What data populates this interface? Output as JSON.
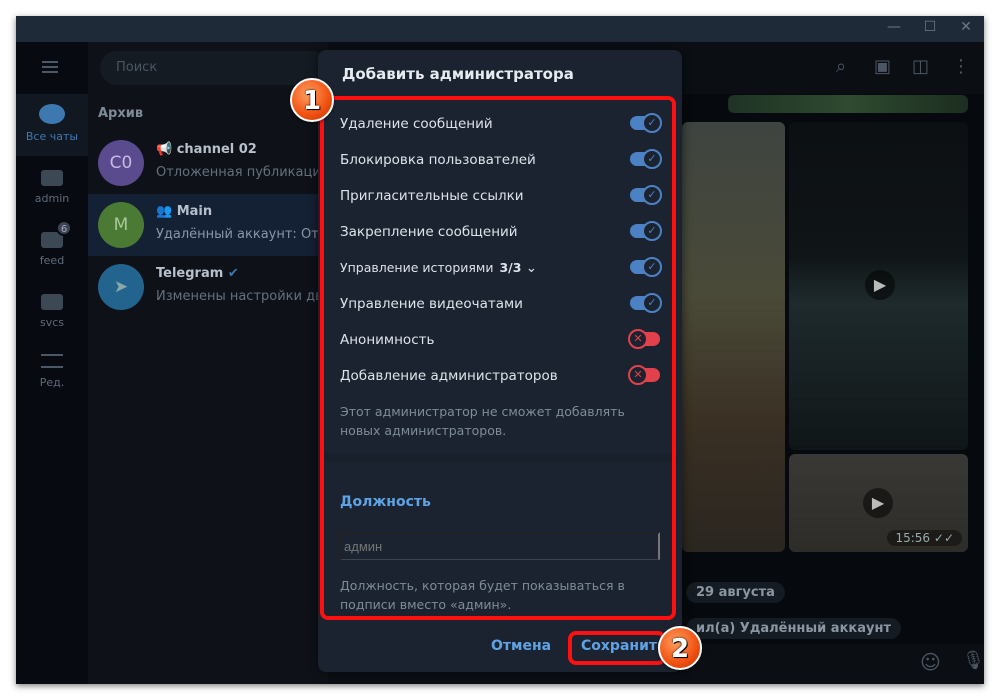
{
  "window": {
    "minimize": "—",
    "maximize": "☐",
    "close": "✕"
  },
  "sidebar": {
    "items": [
      {
        "label": "Все чаты",
        "icon": "chats-icon",
        "active": true
      },
      {
        "label": "admin",
        "icon": "folder-icon"
      },
      {
        "label": "feed",
        "icon": "folder-icon",
        "badge": "6"
      },
      {
        "label": "svcs",
        "icon": "folder-icon"
      },
      {
        "label": "Ред.",
        "icon": "sliders-icon"
      }
    ]
  },
  "chatlist": {
    "search_placeholder": "Поиск",
    "section": "Архив",
    "chats": [
      {
        "avatar": "C0",
        "name": "channel 02",
        "preview": "Отложенная публикация",
        "color": "#5a4a8e"
      },
      {
        "avatar": "M",
        "name": "Main",
        "preview": "Удалённый аккаунт: Отложено",
        "color": "#4a7a34"
      },
      {
        "avatar": "",
        "name": "Telegram",
        "preview": "Изменены настройки двухэтапной",
        "color": "#23648f"
      }
    ]
  },
  "chat": {
    "time": "15:56",
    "date_pill": "29 августа",
    "service_pill": "ил(а) Удалённый аккаунт"
  },
  "dialog": {
    "title": "Добавить администратора",
    "permissions": [
      {
        "label": "Удаление сообщений",
        "enabled": true
      },
      {
        "label": "Блокировка пользователей",
        "enabled": true
      },
      {
        "label": "Пригласительные ссылки",
        "enabled": true
      },
      {
        "label": "Закрепление сообщений",
        "enabled": true
      },
      {
        "label": "Управление историями",
        "count": "3/3",
        "enabled": true
      },
      {
        "label": "Управление видеочатами",
        "enabled": true
      },
      {
        "label": "Анонимность",
        "enabled": false
      },
      {
        "label": "Добавление администраторов",
        "enabled": false
      }
    ],
    "note": "Этот администратор не сможет добавлять новых администраторов.",
    "role_header": "Должность",
    "role_placeholder": "админ",
    "role_note": "Должность, которая будет показываться в подписи вместо «админ».",
    "cancel": "Отмена",
    "save": "Сохранить"
  },
  "annotations": {
    "step1": "1",
    "step2": "2",
    "highlight_color": "#ff1010"
  },
  "colors": {
    "accent": "#5ea3e6",
    "toggle_on": "#4c82c3",
    "toggle_off": "#e2414c"
  }
}
